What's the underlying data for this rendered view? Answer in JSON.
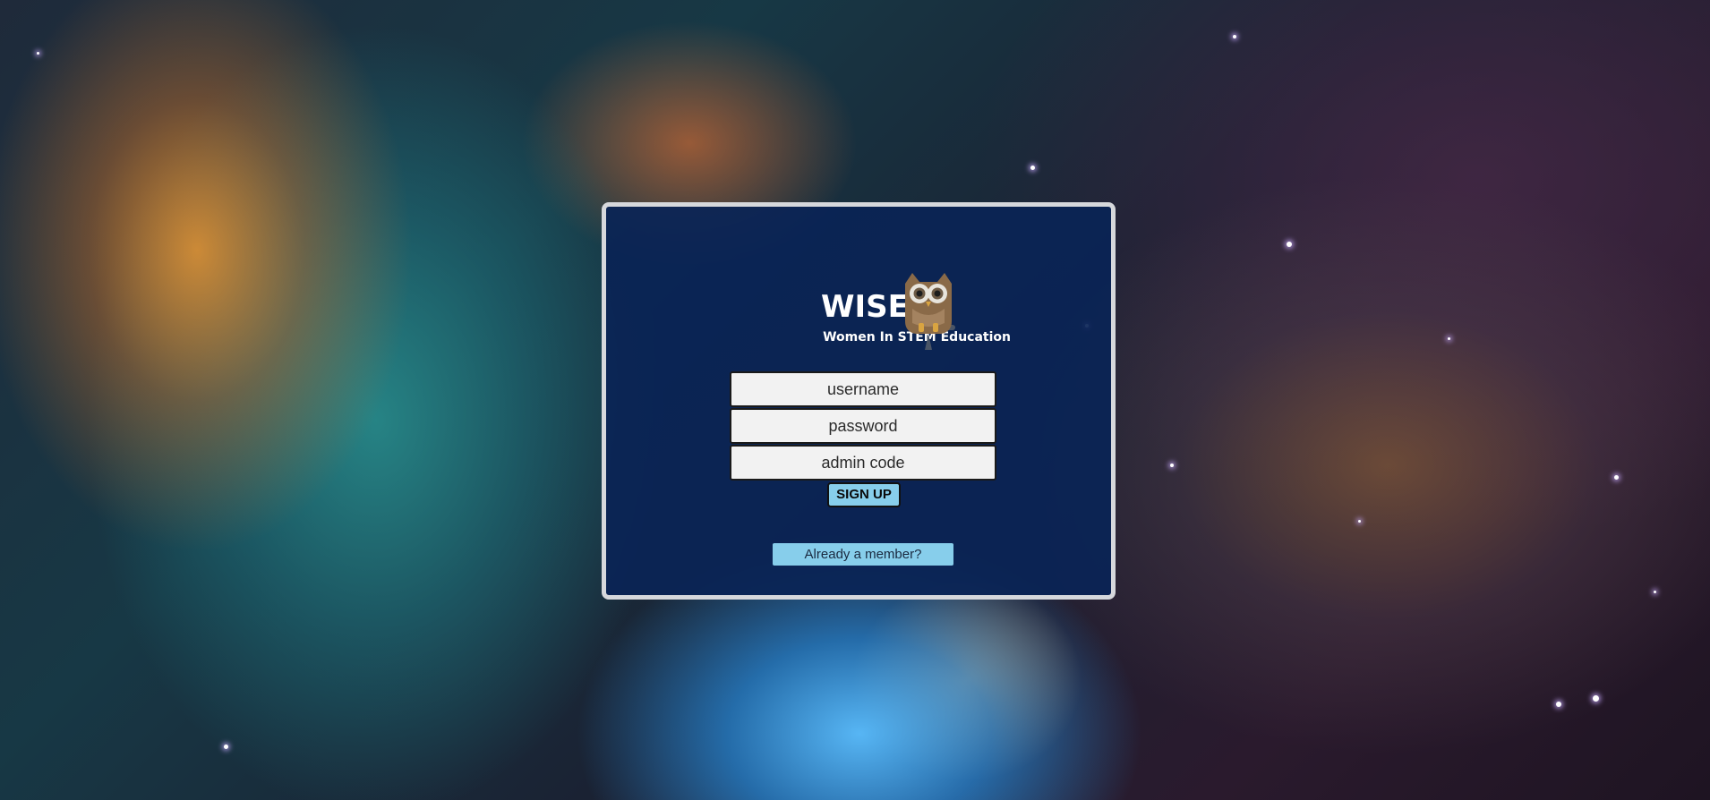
{
  "brand": {
    "title": "WISE",
    "subtitle": "Women In STEM Education",
    "logo_icon": "owl-icon"
  },
  "form": {
    "username_placeholder": "username",
    "password_placeholder": "password",
    "admin_code_placeholder": "admin code",
    "signup_label": "SIGN UP"
  },
  "footer": {
    "member_link_label": "Already a member?"
  },
  "colors": {
    "card_background": "#0a2456",
    "card_border": "#d6d8dc",
    "button_accent": "#87ceeb",
    "input_background": "#f2f2f2"
  }
}
